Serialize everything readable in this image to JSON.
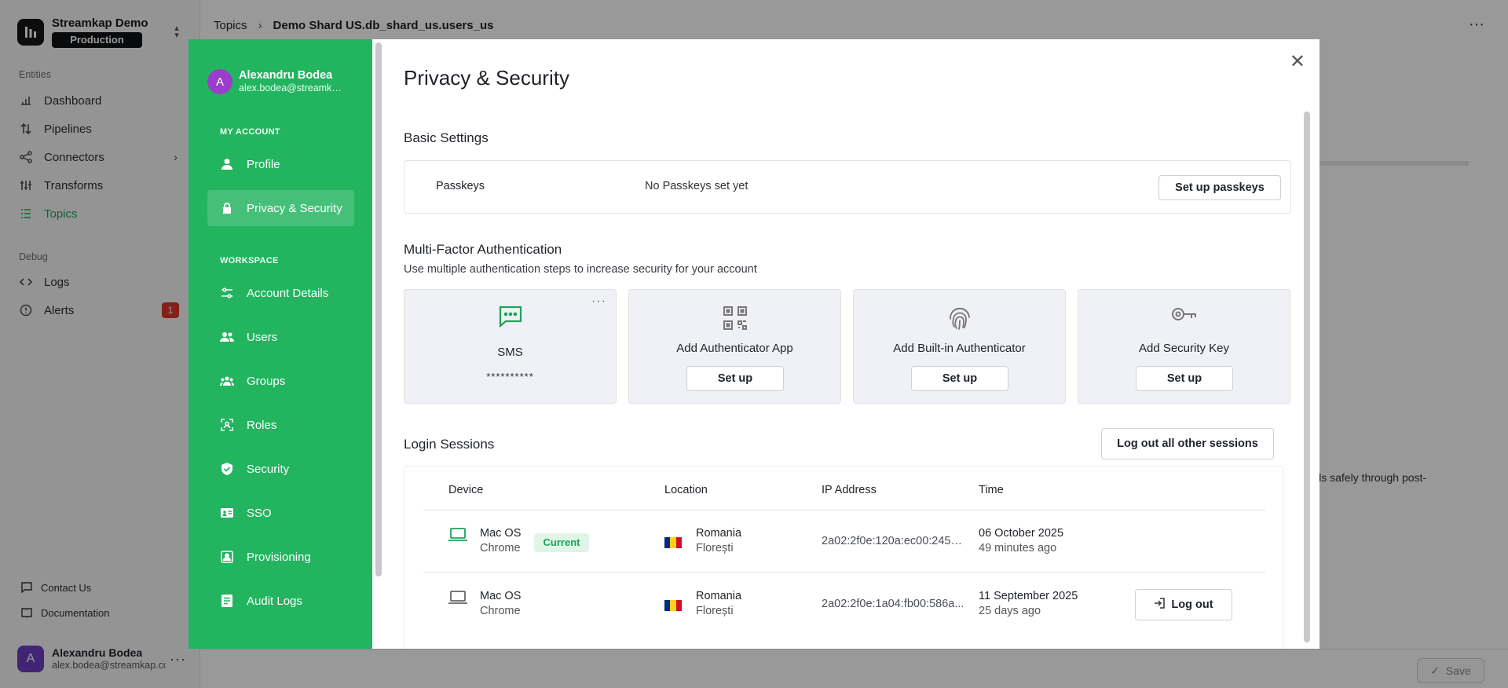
{
  "app": {
    "org_name": "Streamkap Demo",
    "environment": "Production",
    "entities_label": "Entities",
    "debug_label": "Debug",
    "nav": [
      {
        "label": "Dashboard"
      },
      {
        "label": "Pipelines"
      },
      {
        "label": "Connectors"
      },
      {
        "label": "Transforms"
      },
      {
        "label": "Topics"
      }
    ],
    "debug_nav": [
      {
        "label": "Logs"
      },
      {
        "label": "Alerts",
        "count": "1"
      }
    ],
    "footer_links": [
      {
        "label": "Contact Us"
      },
      {
        "label": "Documentation"
      }
    ],
    "user": {
      "initial": "A",
      "name": "Alexandru Bodea",
      "email": "alex.bodea@streamkap.com"
    },
    "breadcrumb": {
      "root": "Topics",
      "current": "Demo Shard US.db_shard_us.users_us"
    },
    "bg_text": "cords safely through post-",
    "save_label": "Save"
  },
  "modal": {
    "user": {
      "initial": "A",
      "name": "Alexandru Bodea",
      "email": "alex.bodea@streamkap.com"
    },
    "my_account_label": "MY ACCOUNT",
    "workspace_label": "WORKSPACE",
    "account_items": [
      {
        "label": "Profile"
      },
      {
        "label": "Privacy & Security"
      }
    ],
    "workspace_items": [
      {
        "label": "Account Details"
      },
      {
        "label": "Users"
      },
      {
        "label": "Groups"
      },
      {
        "label": "Roles"
      },
      {
        "label": "Security"
      },
      {
        "label": "SSO"
      },
      {
        "label": "Provisioning"
      },
      {
        "label": "Audit Logs"
      }
    ],
    "title": "Privacy & Security",
    "basic_settings": {
      "heading": "Basic Settings",
      "passkeys_label": "Passkeys",
      "passkeys_status": "No Passkeys set yet",
      "passkeys_button": "Set up passkeys"
    },
    "mfa": {
      "heading": "Multi-Factor Authentication",
      "description": "Use multiple authentication steps to increase security for your account",
      "methods": [
        {
          "label": "SMS",
          "value": "**********"
        },
        {
          "label": "Add Authenticator App",
          "button": "Set up"
        },
        {
          "label": "Add Built-in Authenticator",
          "button": "Set up"
        },
        {
          "label": "Add Security Key",
          "button": "Set up"
        }
      ]
    },
    "sessions": {
      "heading": "Login Sessions",
      "logout_all": "Log out all other sessions",
      "columns": [
        "Device",
        "Location",
        "IP Address",
        "Time"
      ],
      "rows": [
        {
          "os": "Mac OS",
          "browser": "Chrome",
          "badge": "Current",
          "country": "Romania",
          "city": "Florești",
          "ip": "2a02:2f0e:120a:ec00:2454...",
          "date": "06 October 2025",
          "ago": "49 minutes ago"
        },
        {
          "os": "Mac OS",
          "browser": "Chrome",
          "country": "Romania",
          "city": "Florești",
          "ip": "2a02:2f0e:1a04:fb00:586a...",
          "date": "11 September 2025",
          "ago": "25 days ago",
          "action": "Log out"
        }
      ]
    },
    "colors": {
      "accent": "#23b460",
      "badge_bg": "#dff5e7",
      "alert_red": "#d9362b"
    }
  }
}
